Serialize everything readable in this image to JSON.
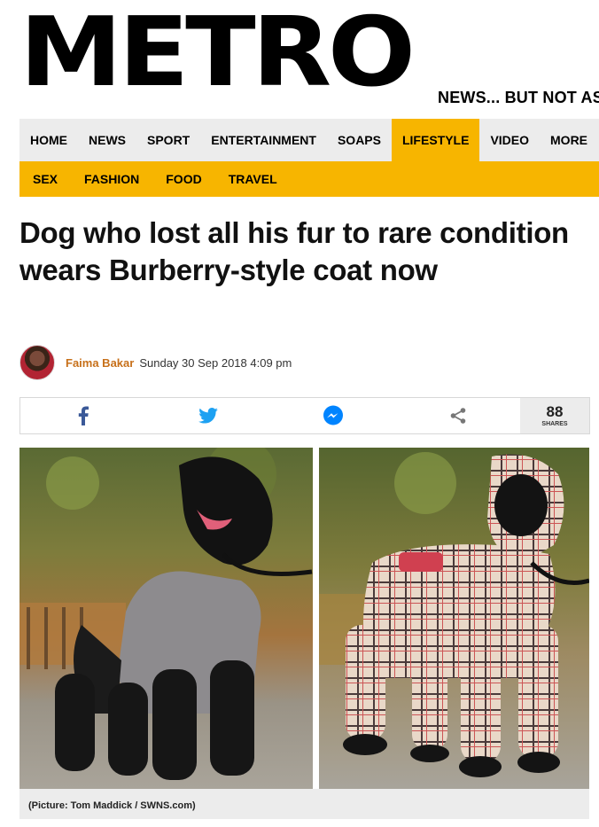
{
  "site": {
    "logo_text": "METRO",
    "tagline": "NEWS... BUT NOT AS"
  },
  "nav": {
    "items": [
      "HOME",
      "NEWS",
      "SPORT",
      "ENTERTAINMENT",
      "SOAPS",
      "LIFESTYLE",
      "VIDEO",
      "MORE"
    ],
    "active": "LIFESTYLE"
  },
  "subnav": {
    "items": [
      "SEX",
      "FASHION",
      "FOOD",
      "TRAVEL"
    ]
  },
  "article": {
    "headline": "Dog who lost all his fur to rare condition wears Burberry-style coat now",
    "author": "Faima Bakar",
    "date": "Sunday 30 Sep 2018 4:09 pm",
    "caption": "(Picture: Tom Maddick / SWNS.com)"
  },
  "share": {
    "count": "88",
    "count_label": "SHARES",
    "icons": [
      "facebook-icon",
      "twitter-icon",
      "messenger-icon",
      "share-icon"
    ]
  },
  "colors": {
    "accent_yellow": "#f7b500",
    "nav_bg": "#ececec",
    "author_orange": "#c7701a",
    "facebook": "#3b5998",
    "twitter": "#1da1f2",
    "messenger": "#0084ff"
  }
}
